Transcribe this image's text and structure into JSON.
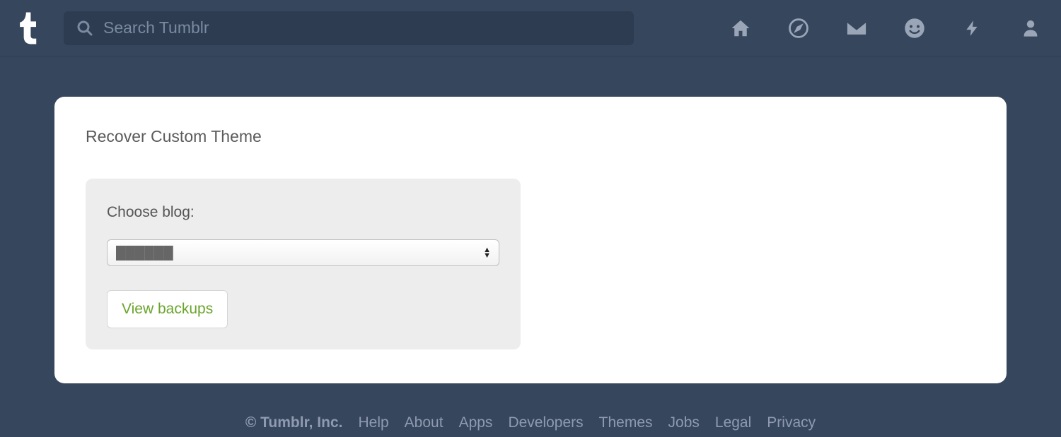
{
  "header": {
    "search_placeholder": "Search Tumblr",
    "search_value": "",
    "icons": [
      "home",
      "explore",
      "inbox",
      "messaging",
      "activity",
      "account"
    ]
  },
  "page": {
    "title": "Recover Custom Theme",
    "panel": {
      "label": "Choose blog:",
      "selected_blog": "██████",
      "button_label": "View backups"
    }
  },
  "footer": {
    "copyright": "© Tumblr, Inc.",
    "links": [
      "Help",
      "About",
      "Apps",
      "Developers",
      "Themes",
      "Jobs",
      "Legal",
      "Privacy"
    ]
  }
}
